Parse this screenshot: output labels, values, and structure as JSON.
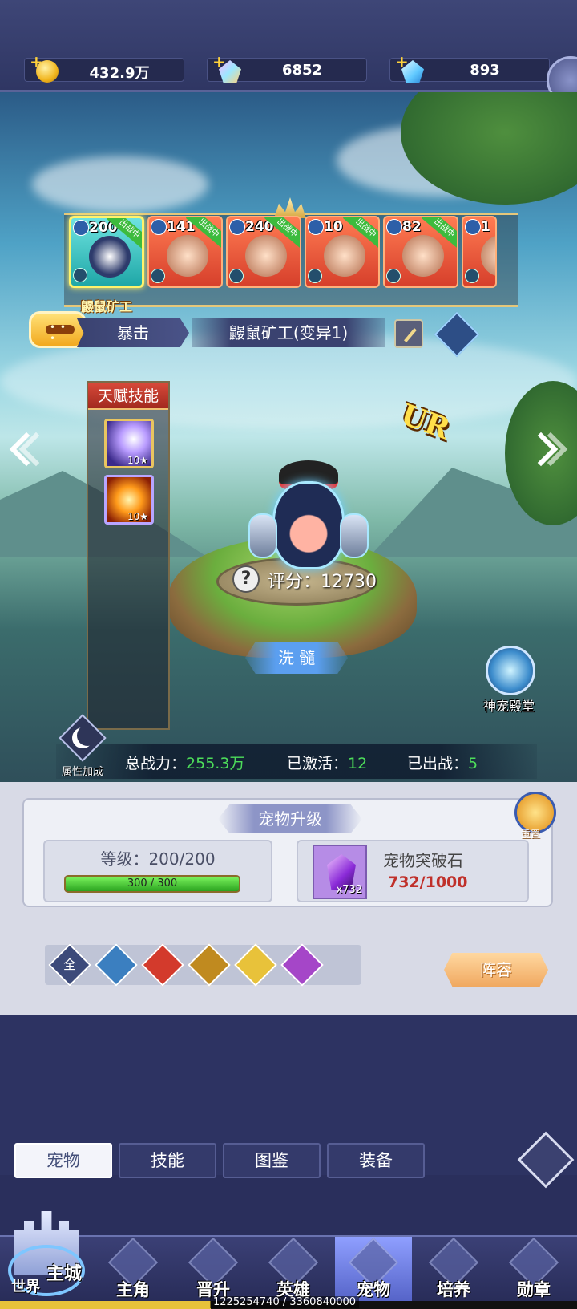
{
  "resources": {
    "gold": "432.9万",
    "crystal": "6852",
    "diamond": "893"
  },
  "pets": [
    {
      "level": "200",
      "name": "鼹鼠矿工",
      "status": "出战中",
      "selected": true
    },
    {
      "level": "141",
      "name": "",
      "status": "出战中",
      "selected": false
    },
    {
      "level": "240",
      "name": "",
      "status": "出战中",
      "selected": false
    },
    {
      "level": "10",
      "name": "",
      "status": "出战中",
      "selected": false
    },
    {
      "level": "82",
      "name": "",
      "status": "出战中",
      "selected": false
    },
    {
      "level": "1",
      "name": "",
      "status": "",
      "selected": false
    }
  ],
  "info": {
    "trait": "暴击",
    "pet_full_name": "鼹鼠矿工(变异1)"
  },
  "talent": {
    "title": "天赋技能",
    "skills": [
      {
        "level": "10★"
      },
      {
        "level": "10★"
      }
    ]
  },
  "rarity": "UR",
  "score": "评分：12730",
  "score_help": "?",
  "refine_button": "洗 髓",
  "hall_label": "神宠殿堂",
  "stats": {
    "attr_bonus": "属性加成",
    "total_power_label": "总战力：",
    "total_power_value": "255.3万",
    "activated_label": "已激活：",
    "activated_value": "12",
    "deployed_label": "已出战：",
    "deployed_value": "5"
  },
  "upgrade": {
    "title": "宠物升级",
    "level_text": "等级：200/200",
    "exp_text": "300 / 300",
    "exp_progress": 1.0,
    "stone_name": "宠物突破石",
    "stone_count": "x732",
    "stone_progress_text": "732/1000",
    "reset_label": "重置"
  },
  "element_filters": [
    "全",
    "",
    "",
    "",
    "",
    ""
  ],
  "element_colors": [
    "#3c4a7a",
    "#3b7fc0",
    "#d33a2c",
    "#c08a1f",
    "#e8c23a",
    "#a546c8"
  ],
  "lineup_button": "阵容",
  "subtabs": [
    "宠物",
    "技能",
    "图鉴",
    "装备"
  ],
  "nav": {
    "world_top": "主城",
    "world_bottom": "世界",
    "items": [
      "主角",
      "晋升",
      "英雄",
      "宠物",
      "培养",
      "勋章"
    ],
    "active": "宠物"
  },
  "exp_bar": {
    "text": "1225254740 / 3360840000",
    "progress": 0.3646
  }
}
